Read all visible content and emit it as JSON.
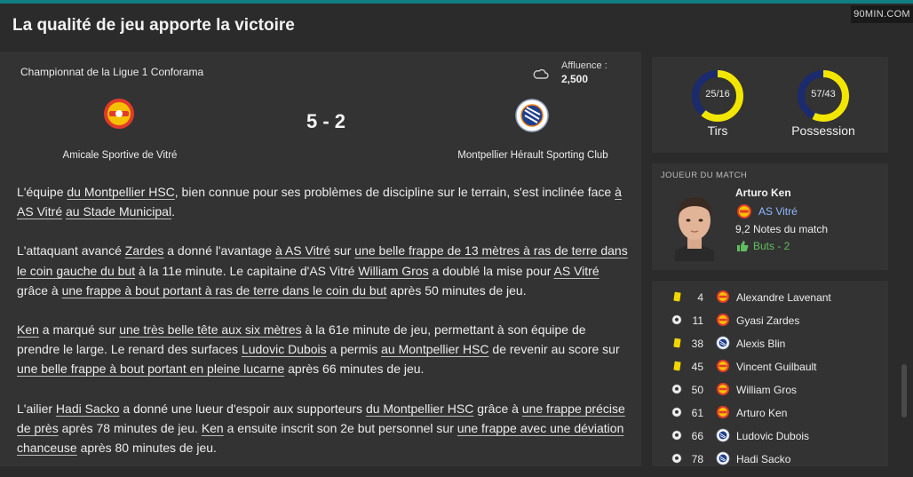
{
  "brand": "90MIN.COM",
  "headline": "La qualité de jeu apporte la victoire",
  "match": {
    "competition": "Championnat de la Ligue 1 Conforama",
    "attendance_label": "Affluence :",
    "attendance_value": "2,500",
    "score": "5 - 2",
    "home_team": "Amicale Sportive de Vitré",
    "away_team": "Montpellier Hérault Sporting Club",
    "weather_icon": "cloud-icon"
  },
  "report": {
    "p1": [
      {
        "t": "L'équipe "
      },
      {
        "t": "du Montpellier HSC",
        "u": true
      },
      {
        "t": ", bien connue pour ses problèmes de discipline sur le terrain, s'est inclinée face "
      },
      {
        "t": "à AS Vitré",
        "u": true
      },
      {
        "t": " "
      },
      {
        "t": "au Stade Municipal",
        "u": true
      },
      {
        "t": "."
      }
    ],
    "p2": [
      {
        "t": "L'attaquant avancé "
      },
      {
        "t": "Zardes",
        "u": true
      },
      {
        "t": " a donné l'avantage "
      },
      {
        "t": "à AS Vitré",
        "u": true
      },
      {
        "t": " sur "
      },
      {
        "t": "une belle frappe de 13 mètres à ras de terre dans le coin gauche du but",
        "u": true
      },
      {
        "t": " à la 11e minute. Le capitaine d'AS Vitré "
      },
      {
        "t": "William Gros",
        "u": true
      },
      {
        "t": " a doublé la mise pour "
      },
      {
        "t": "AS Vitré",
        "u": true
      },
      {
        "t": " grâce à "
      },
      {
        "t": "une frappe à bout portant à ras de terre dans le coin du but",
        "u": true
      },
      {
        "t": " après 50 minutes de jeu."
      }
    ],
    "p3": [
      {
        "t": "Ken",
        "u": true
      },
      {
        "t": " a marqué sur "
      },
      {
        "t": "une très belle tête aux six mètres",
        "u": true
      },
      {
        "t": " à la 61e minute de jeu, permettant à son équipe de prendre le large. Le renard des surfaces "
      },
      {
        "t": "Ludovic Dubois",
        "u": true
      },
      {
        "t": " a permis "
      },
      {
        "t": "au Montpellier HSC",
        "u": true
      },
      {
        "t": " de revenir au score sur "
      },
      {
        "t": "une belle frappe à bout portant en pleine lucarne",
        "u": true
      },
      {
        "t": " après 66 minutes de jeu."
      }
    ],
    "p4": [
      {
        "t": "L'ailier "
      },
      {
        "t": "Hadi Sacko",
        "u": true
      },
      {
        "t": " a donné une lueur d'espoir aux supporteurs "
      },
      {
        "t": "du Montpellier HSC",
        "u": true
      },
      {
        "t": " grâce à "
      },
      {
        "t": "une frappe précise de près",
        "u": true
      },
      {
        "t": " après 78 minutes de jeu. "
      },
      {
        "t": "Ken",
        "u": true
      },
      {
        "t": " a ensuite inscrit son 2e but personnel sur "
      },
      {
        "t": "une frappe avec une déviation chanceuse",
        "u": true
      },
      {
        "t": " après 80 minutes de jeu."
      }
    ]
  },
  "stats": {
    "shots": {
      "value": "25/16",
      "label": "Tirs",
      "home": 25,
      "away": 16
    },
    "possession": {
      "value": "57/43",
      "label": "Possession",
      "home": 57,
      "away": 43
    },
    "home_color": "#f2e600",
    "away_color": "#1c2a6e"
  },
  "motm": {
    "heading": "JOUEUR DU MATCH",
    "name": "Arturo Ken",
    "club": "AS Vitré",
    "rating": "9,2 Notes du match",
    "goals": "Buts - 2"
  },
  "events": [
    {
      "type": "yellow-card",
      "minute": "4",
      "team": "home",
      "player": "Alexandre Lavenant"
    },
    {
      "type": "goal",
      "minute": "11",
      "team": "home",
      "player": "Gyasi Zardes"
    },
    {
      "type": "yellow-card",
      "minute": "38",
      "team": "away",
      "player": "Alexis Blin"
    },
    {
      "type": "yellow-card",
      "minute": "45",
      "team": "home",
      "player": "Vincent Guilbault"
    },
    {
      "type": "goal",
      "minute": "50",
      "team": "home",
      "player": "William Gros"
    },
    {
      "type": "goal",
      "minute": "61",
      "team": "home",
      "player": "Arturo Ken"
    },
    {
      "type": "goal",
      "minute": "66",
      "team": "away",
      "player": "Ludovic Dubois"
    },
    {
      "type": "goal",
      "minute": "78",
      "team": "away",
      "player": "Hadi Sacko"
    }
  ]
}
